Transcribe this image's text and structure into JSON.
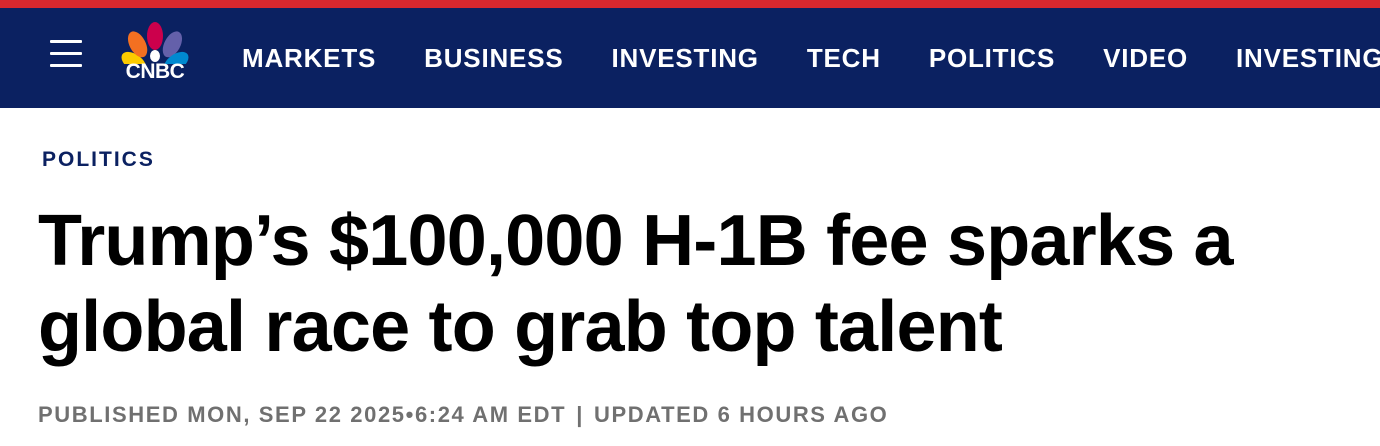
{
  "header": {
    "stripe_color": "#d8282f",
    "bar_color": "#0b2161",
    "menu_icon": "hamburger-menu-icon",
    "logo_text": "CNBC",
    "nav_items": [
      "MARKETS",
      "BUSINESS",
      "INVESTING",
      "TECH",
      "POLITICS",
      "VIDEO",
      "INVESTING CLUB"
    ]
  },
  "article": {
    "category": "POLITICS",
    "headline": "Trump’s $100,000 H-1B fee sparks a global race to grab top talent",
    "published": "PUBLISHED MON, SEP 22 2025•6:24 AM EDT",
    "separator": "|",
    "updated": "UPDATED 6 HOURS AGO"
  }
}
